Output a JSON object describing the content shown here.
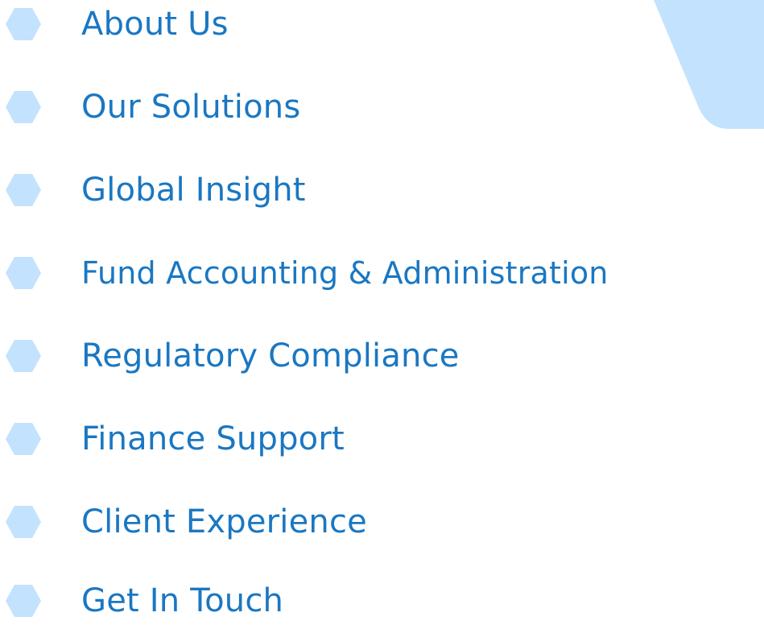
{
  "colors": {
    "link_text": "#1a77c2",
    "bullet": "#c3e2fd",
    "decor": "#c3e2fd",
    "background": "#ffffff"
  },
  "decor": {
    "icon": "light-blue-corner-shape"
  },
  "nav": {
    "bullet_icon": "hexagon-bullet-icon",
    "items": [
      {
        "label": "About Us"
      },
      {
        "label": "Our Solutions"
      },
      {
        "label": "Global Insight"
      },
      {
        "label": "Fund Accounting & Administration"
      },
      {
        "label": "Regulatory Compliance"
      },
      {
        "label": "Finance Support"
      },
      {
        "label": "Client Experience"
      },
      {
        "label": "Get In Touch"
      }
    ]
  }
}
